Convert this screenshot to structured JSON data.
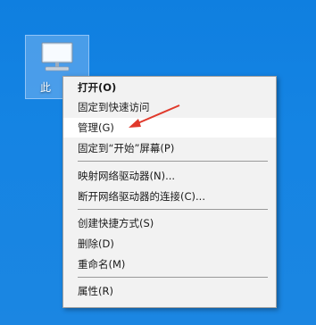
{
  "desktop": {
    "icon_label": "此",
    "icon_name": "computer-icon"
  },
  "menu": {
    "items": [
      {
        "label": "打开(O)",
        "bold": true
      },
      {
        "label": "固定到快速访问"
      },
      {
        "label": "管理(G)"
      },
      {
        "label": "固定到“开始”屏幕(P)"
      },
      {
        "label": "映射网络驱动器(N)..."
      },
      {
        "label": "断开网络驱动器的连接(C)..."
      },
      {
        "label": "创建快捷方式(S)"
      },
      {
        "label": "删除(D)"
      },
      {
        "label": "重命名(M)"
      },
      {
        "label": "属性(R)"
      }
    ]
  },
  "colors": {
    "desktop_bg": "#1584e3",
    "menu_bg": "#f2f2f2",
    "arrow": "#e0392b"
  }
}
